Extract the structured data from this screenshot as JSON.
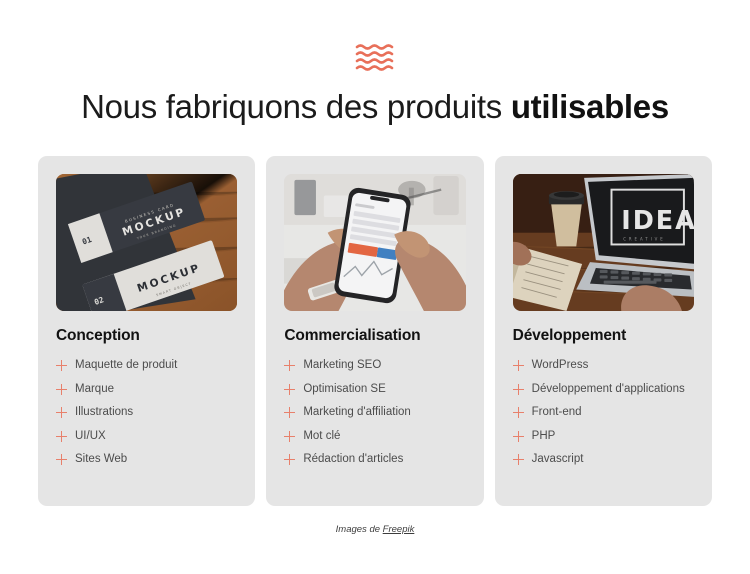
{
  "decoration": {
    "icon": "wave-lines-icon",
    "color": "#e8705a",
    "line_count": 4
  },
  "heading": {
    "text_normal": "Nous fabriquons des produits ",
    "text_bold": "utilisables"
  },
  "cards": [
    {
      "image_name": "business-card-mockup-photo",
      "title": "Conception",
      "items": [
        "Maquette de produit",
        "Marque",
        "Illustrations",
        "UI/UX",
        "Sites Web"
      ]
    },
    {
      "image_name": "smartphone-in-hands-photo",
      "title": "Commercialisation",
      "items": [
        "Marketing SEO",
        "Optimisation SE",
        "Marketing d'affiliation",
        "Mot clé",
        "Rédaction d'articles"
      ]
    },
    {
      "image_name": "laptop-ideas-desk-photo",
      "title": "Développement",
      "items": [
        "WordPress",
        "Développement d'applications",
        "Front-end",
        "PHP",
        "Javascript"
      ]
    }
  ],
  "credit": {
    "prefix": "Images de ",
    "link_label": "Freepik"
  },
  "colors": {
    "accent": "#e8705a",
    "plus": "#e8806b",
    "card_bg": "#e5e5e5",
    "page_bg": "#ffffff",
    "heading": "#1b1b1b"
  }
}
